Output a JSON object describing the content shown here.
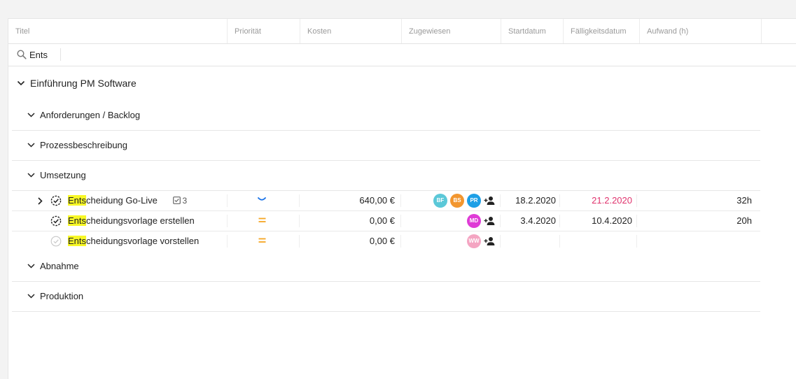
{
  "columns": {
    "title": "Titel",
    "priority": "Priorität",
    "cost": "Kosten",
    "assigned": "Zugewiesen",
    "start": "Startdatum",
    "due": "Fälligkeitsdatum",
    "effort": "Aufwand (h)"
  },
  "search": {
    "value": "Ents"
  },
  "project": {
    "name": "Einführung PM Software"
  },
  "groups": [
    {
      "label": "Anforderungen / Backlog"
    },
    {
      "label": "Prozessbeschreibung"
    },
    {
      "label": "Umsetzung"
    },
    {
      "label": "Abnahme"
    },
    {
      "label": "Produktion"
    }
  ],
  "tasks": [
    {
      "highlight": "Ents",
      "rest": "cheidung Go-Live",
      "subtasks": "3",
      "priority": "low",
      "cost": "640,00 €",
      "assignees": [
        {
          "initials": "BF",
          "color": "#5bc8d8"
        },
        {
          "initials": "BS",
          "color": "#f2962f"
        },
        {
          "initials": "PR",
          "color": "#1d9fe6"
        }
      ],
      "start": "18.2.2020",
      "due": "21.2.2020",
      "due_color": "#e0336d",
      "effort": "32h",
      "status": "in-progress"
    },
    {
      "highlight": "Ents",
      "rest": "cheidungsvorlage erstellen",
      "priority": "medium",
      "cost": "0,00 €",
      "assignees": [
        {
          "initials": "MD",
          "color": "#df3bd6"
        }
      ],
      "start": "3.4.2020",
      "due": "10.4.2020",
      "effort": "20h",
      "status": "in-progress"
    },
    {
      "highlight": "Ents",
      "rest": "cheidungsvorlage vorstellen",
      "priority": "medium",
      "cost": "0,00 €",
      "assignees": [
        {
          "initials": "WW",
          "color": "#f4a5c2"
        }
      ],
      "start": "",
      "due": "",
      "effort": "",
      "status": "open"
    }
  ],
  "colors": {
    "priority_low": "#1a73e8",
    "priority_medium": "#f5a623",
    "highlight": "#f7f726"
  }
}
